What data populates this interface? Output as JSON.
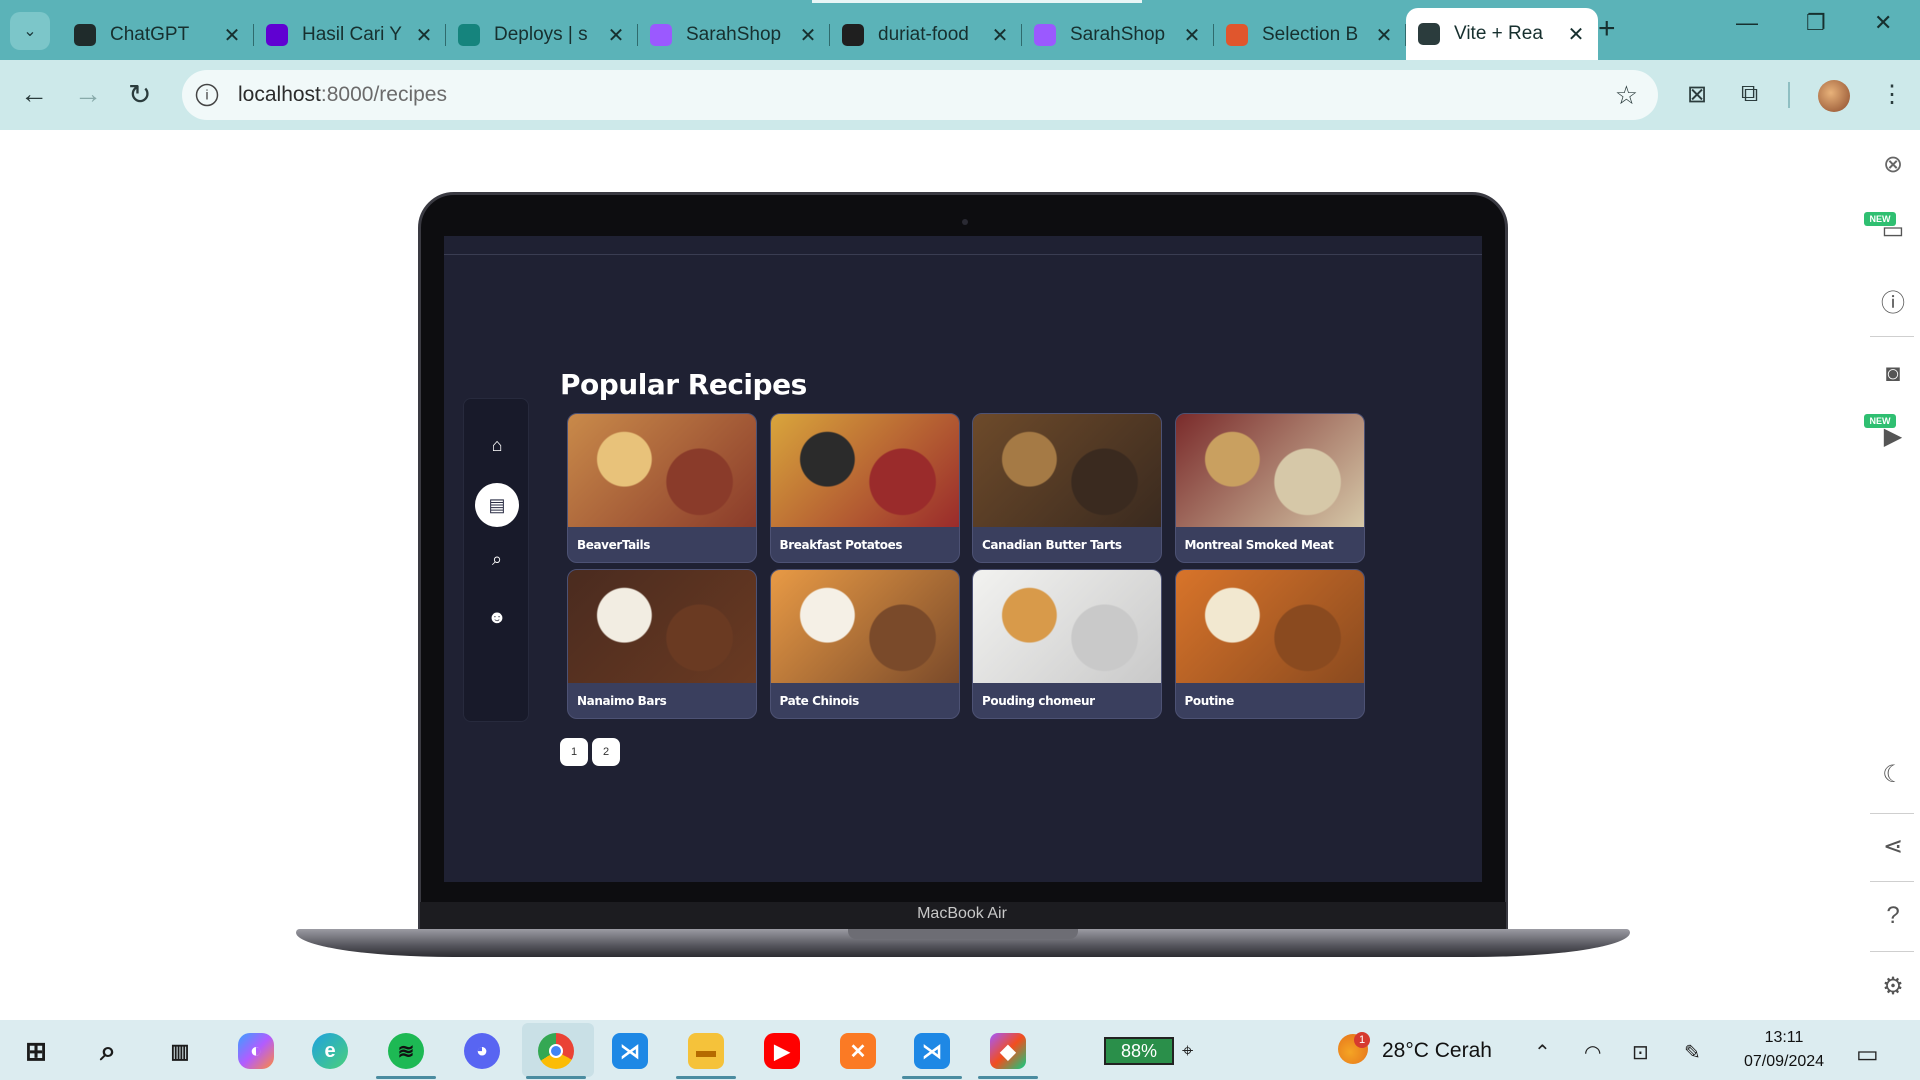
{
  "browser": {
    "tabs": [
      {
        "title": "ChatGPT",
        "favicon": "chatgpt-icon",
        "color": "#1f2b2b"
      },
      {
        "title": "Hasil Cari Y",
        "favicon": "yahoo-icon",
        "color": "#6001d2"
      },
      {
        "title": "Deploys | s",
        "favicon": "netlify-icon",
        "color": "#15847d"
      },
      {
        "title": "SarahShop",
        "favicon": "vite-icon",
        "color": "#9b59ff"
      },
      {
        "title": "duriat-food",
        "favicon": "github-icon",
        "color": "#1f1f1f"
      },
      {
        "title": "SarahShop",
        "favicon": "vite-icon",
        "color": "#9b59ff"
      },
      {
        "title": "Selection B",
        "favicon": "stats-icon",
        "color": "#e0562d"
      },
      {
        "title": "Vite + Rea",
        "favicon": "globe-icon",
        "color": "#2b3c3d"
      }
    ],
    "active_tab_index": 7,
    "url_host": "localhost",
    "url_path": ":8000/recipes"
  },
  "laptop": {
    "label": "MacBook Air"
  },
  "app": {
    "title": "Popular Recipes",
    "nav": [
      {
        "icon": "home-icon",
        "glyph": "⌂"
      },
      {
        "icon": "book-icon",
        "glyph": "▤"
      },
      {
        "icon": "search-icon",
        "glyph": "⌕"
      },
      {
        "icon": "users-icon",
        "glyph": "☻"
      }
    ],
    "active_nav_index": 1,
    "recipes": [
      {
        "name": "BeaverTails",
        "img": [
          "#c98a4a",
          "#e8c27a",
          "#8a3b2a"
        ]
      },
      {
        "name": "Breakfast Potatoes",
        "img": [
          "#d9a53c",
          "#2b2b2b",
          "#9a2b2b"
        ]
      },
      {
        "name": "Canadian Butter Tarts",
        "img": [
          "#6d4a2a",
          "#a57a45",
          "#3a2a1f"
        ]
      },
      {
        "name": "Montreal Smoked Meat",
        "img": [
          "#7a2b2b",
          "#c9a060",
          "#d6c8a8"
        ]
      },
      {
        "name": "Nanaimo Bars",
        "img": [
          "#4a2b1f",
          "#f2ede2",
          "#6a3a22"
        ]
      },
      {
        "name": "Pate Chinois",
        "img": [
          "#e89a45",
          "#f5f0e6",
          "#7a4a2a"
        ]
      },
      {
        "name": "Pouding chomeur",
        "img": [
          "#f2f2f0",
          "#d89a4a",
          "#c9c9c9"
        ]
      },
      {
        "name": "Poutine",
        "img": [
          "#d8742a",
          "#f2e8d0",
          "#8a4a1f"
        ]
      }
    ],
    "pages": [
      "1",
      "2"
    ]
  },
  "taskbar": {
    "battery": "88%",
    "weather": "28°C  Cerah",
    "weather_alerts": "1",
    "time": "13:11",
    "date": "07/09/2024"
  }
}
